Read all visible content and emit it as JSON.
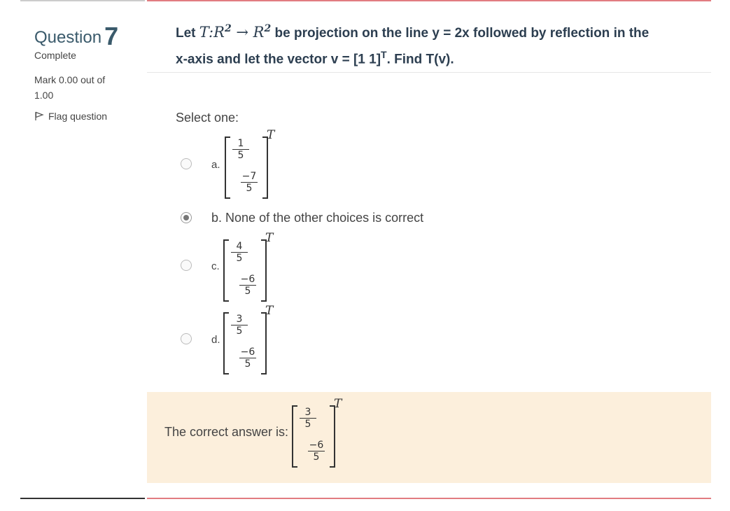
{
  "info": {
    "question_word": "Question",
    "question_number": "7",
    "state": "Complete",
    "grade": "Mark 0.00 out of 1.00",
    "flag_label": "Flag question"
  },
  "question": {
    "text_let": "Let",
    "math_T": "T:R",
    "math_arrow": "→",
    "math_R": "R",
    "exp": "2",
    "text_rest": "be projection on the line y = 2x followed by reflection in the",
    "line2": "x-axis and let the vector v = [1  1]",
    "line2_sup": "T",
    "line2_end": ". Find T(v)."
  },
  "prompt": "Select one:",
  "options": [
    {
      "letter": "a.",
      "checked": false,
      "top_num": "1",
      "top_den": "5",
      "bot_num": "−7",
      "bot_den": "5",
      "sup": "T"
    },
    {
      "letter": "b.",
      "checked": true,
      "text": "None of the other choices is correct"
    },
    {
      "letter": "c.",
      "checked": false,
      "top_num": "4",
      "top_den": "5",
      "bot_num": "−6",
      "bot_den": "5",
      "sup": "T"
    },
    {
      "letter": "d.",
      "checked": false,
      "top_num": "3",
      "top_den": "5",
      "bot_num": "−6",
      "bot_den": "5",
      "sup": "T"
    }
  ],
  "feedback": {
    "label": "The correct answer is:",
    "top_num": "3",
    "top_den": "5",
    "bot_num": "−6",
    "bot_den": "5",
    "sup": "T"
  },
  "colors": {
    "accent_line": "#e27c81",
    "feedback_bg": "#fcefdc",
    "title": "#3a5a6b"
  }
}
